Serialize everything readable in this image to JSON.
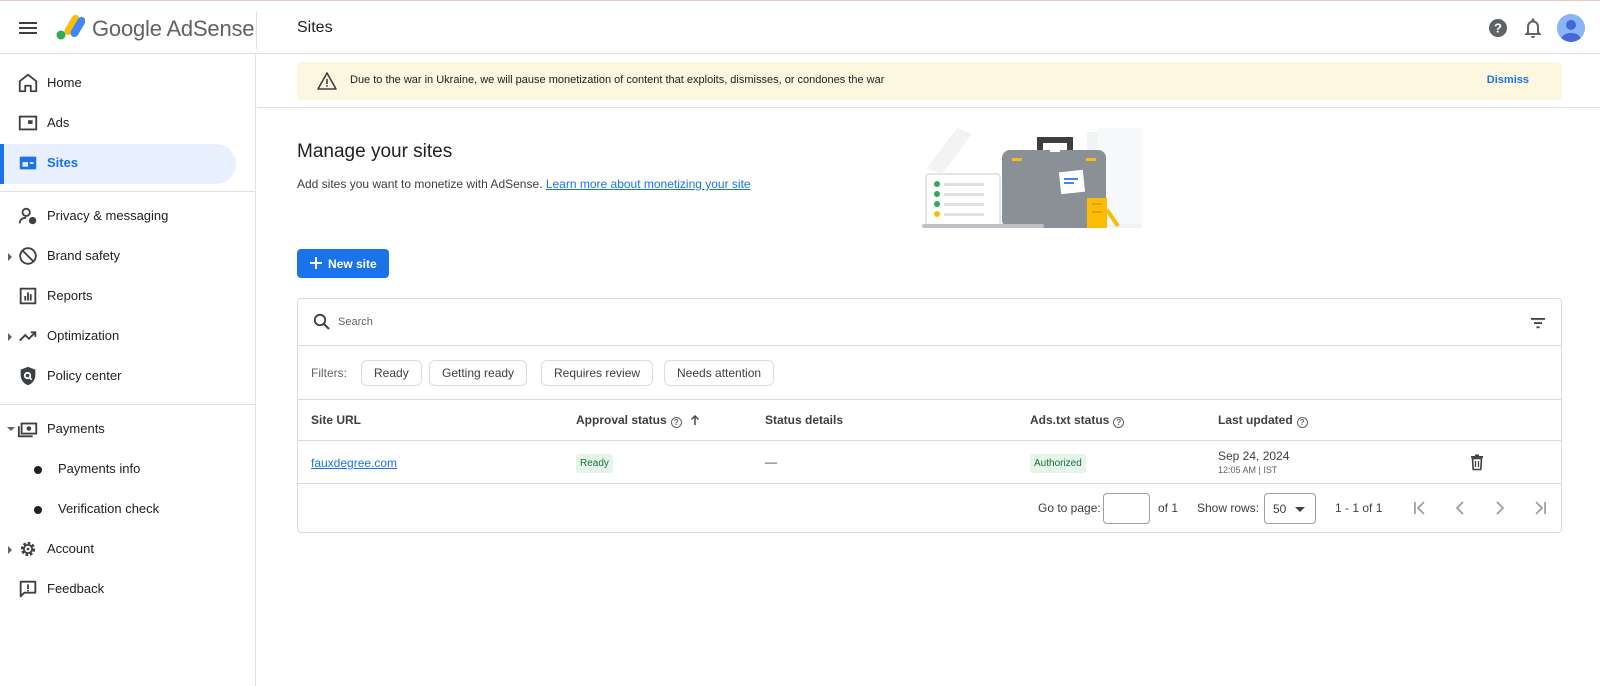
{
  "header": {
    "brand_google": "Google",
    "brand_product": "AdSense",
    "page_title": "Sites"
  },
  "sidebar": {
    "items": [
      {
        "label": "Home",
        "icon": "home-icon"
      },
      {
        "label": "Ads",
        "icon": "ads-icon"
      },
      {
        "label": "Sites",
        "icon": "sites-icon",
        "active": true
      },
      {
        "label": "Privacy & messaging",
        "icon": "privacy-icon"
      },
      {
        "label": "Brand safety",
        "icon": "block-icon"
      },
      {
        "label": "Reports",
        "icon": "reports-icon"
      },
      {
        "label": "Optimization",
        "icon": "trending-icon"
      },
      {
        "label": "Policy center",
        "icon": "policy-icon"
      },
      {
        "label": "Payments",
        "icon": "payments-icon"
      },
      {
        "label": "Payments info"
      },
      {
        "label": "Verification check"
      },
      {
        "label": "Account",
        "icon": "gear-icon"
      },
      {
        "label": "Feedback",
        "icon": "feedback-icon"
      }
    ]
  },
  "banner": {
    "message": "Due to the war in Ukraine, we will pause monetization of content that exploits, dismisses, or condones the war",
    "dismiss": "Dismiss"
  },
  "main": {
    "title": "Manage your sites",
    "subtitle": "Add sites you want to monetize with AdSense.",
    "learn_more": "Learn more about monetizing your site",
    "new_site": "New site"
  },
  "table": {
    "search_placeholder": "Search",
    "filters_label": "Filters:",
    "filters": [
      "Ready",
      "Getting ready",
      "Requires review",
      "Needs attention"
    ],
    "columns": [
      "Site URL",
      "Approval status",
      "Status details",
      "Ads.txt status",
      "Last updated"
    ],
    "rows": [
      {
        "site_url": "fauxdegree.com",
        "approval_status": "Ready",
        "status_details": "—",
        "ads_txt_status": "Authorized",
        "last_updated_date": "Sep 24, 2024",
        "last_updated_time": "12:05 AM | IST"
      }
    ],
    "pager": {
      "go_to_page": "Go to page:",
      "of_pages": "of 1",
      "show_rows": "Show rows:",
      "rows_value": "50",
      "range": "1 - 1 of 1"
    }
  },
  "colors": {
    "accent": "#1a73e8",
    "banner_bg": "#fef7e0",
    "ready_badge_bg": "#e6f4ea",
    "ready_badge_text": "#137333"
  }
}
